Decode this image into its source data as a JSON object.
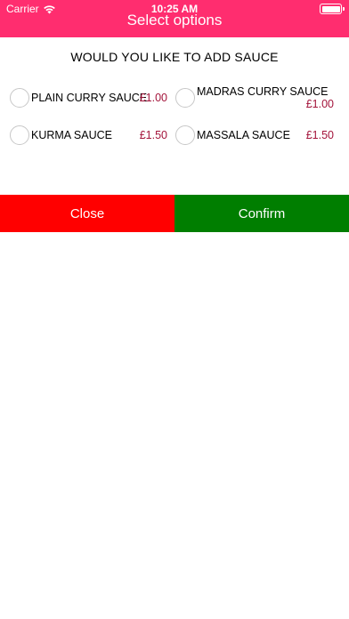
{
  "status_bar": {
    "carrier": "Carrier",
    "time": "10:25 AM"
  },
  "header": {
    "title": "Select options",
    "color": "#ff2d6f"
  },
  "question": "WOULD YOU LIKE TO ADD SAUCE",
  "options": [
    {
      "label": "PLAIN CURRY SAUCE",
      "price": "£1.00",
      "selected": false
    },
    {
      "label": "MADRAS CURRY SAUCE",
      "price": "£1.00",
      "selected": false
    },
    {
      "label": "KURMA SAUCE",
      "price": "£1.50",
      "selected": false
    },
    {
      "label": "MASSALA SAUCE",
      "price": "£1.50",
      "selected": false
    }
  ],
  "buttons": {
    "close_label": "Close",
    "confirm_label": "Confirm",
    "close_color": "#ff0000",
    "confirm_color": "#007e00"
  },
  "price_color": "#a3133a"
}
